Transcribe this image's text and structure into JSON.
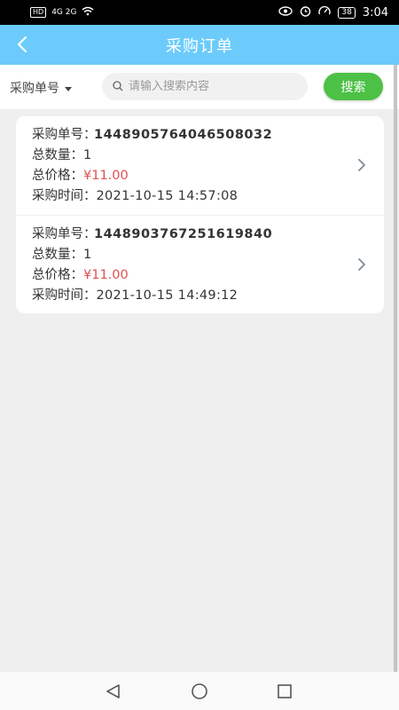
{
  "status_bar": {
    "left_text": "4G 2G",
    "hd": "HD",
    "battery": "38",
    "time": "3:04"
  },
  "header": {
    "title": "采购订单",
    "back_icon": "chevron-left-icon"
  },
  "search": {
    "field_label": "采购单号",
    "placeholder": "请输入搜索内容",
    "value": "",
    "button_label": "搜索"
  },
  "labels": {
    "order_no": "采购单号：",
    "quantity": "总数量：",
    "total_price": "总价格：",
    "purchase_time": "采购时间："
  },
  "orders": [
    {
      "order_no": "1448905764046508032",
      "quantity": "1",
      "total_price": "¥11.00",
      "purchase_time": "2021-10-15 14:57:08"
    },
    {
      "order_no": "1448903767251619840",
      "quantity": "1",
      "total_price": "¥11.00",
      "purchase_time": "2021-10-15 14:49:12"
    }
  ],
  "colors": {
    "header_bg": "#6ccbfb",
    "search_button": "#4cc146",
    "price": "#e05050"
  }
}
